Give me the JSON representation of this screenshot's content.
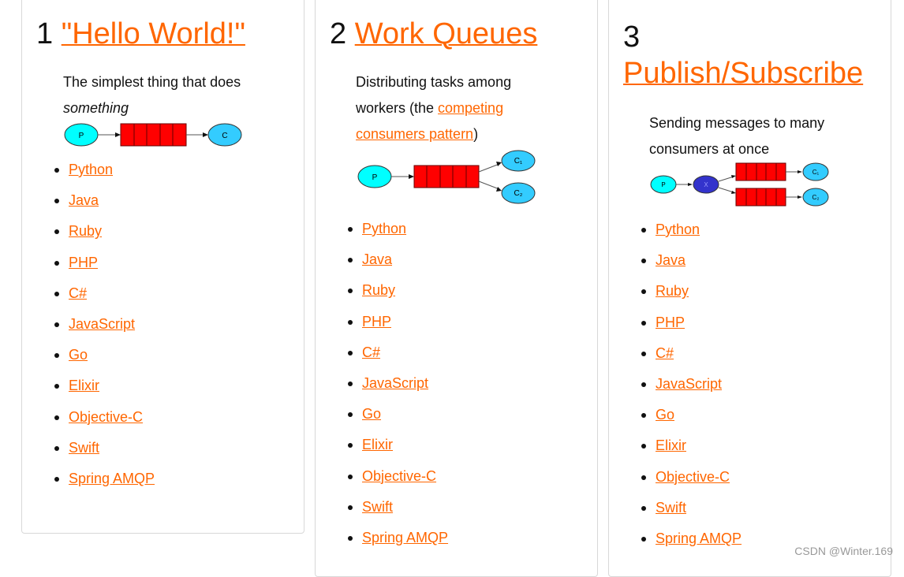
{
  "tutorials": [
    {
      "number": "1",
      "title": "\"Hello World!\"",
      "desc_before": "The simplest thing that does ",
      "desc_em": "something",
      "diagram": {
        "producer": "P",
        "consumer": "C"
      }
    },
    {
      "number": "2",
      "title": "Work Queues",
      "desc_before": "Distributing tasks among workers (the ",
      "desc_link": "competing consumers pattern",
      "desc_after": ")",
      "diagram": {
        "producer": "P",
        "consumer1": "C₁",
        "consumer2": "C₂"
      }
    },
    {
      "number": "3",
      "title": "Publish/Subscribe",
      "desc_before": "Sending messages to many consumers at once",
      "diagram": {
        "producer": "P",
        "exchange": "X",
        "consumer1": "C₁",
        "consumer2": "C₂"
      }
    }
  ],
  "languages": [
    "Python",
    "Java",
    "Ruby",
    "PHP",
    "C#",
    "JavaScript",
    "Go",
    "Elixir",
    "Objective-C",
    "Swift",
    "Spring AMQP"
  ],
  "colors": {
    "link": "#ff6600",
    "queue": "#ff0000",
    "producer": "#00ffff",
    "consumer": "#33ccff",
    "exchange": "#3333cc"
  },
  "watermark": "CSDN @Winter.169"
}
